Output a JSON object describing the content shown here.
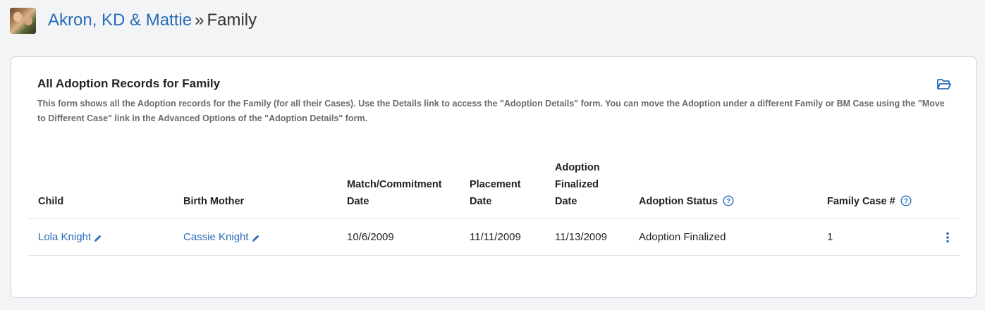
{
  "header": {
    "family_name": "Akron, KD & Mattie",
    "separator": "»",
    "current": "Family"
  },
  "card": {
    "title": "All Adoption Records for Family",
    "description": "This form shows all the Adoption records for the Family (for all their Cases). Use the Details link to access the \"Adoption Details\" form. You can move the Adoption under a different Family or BM Case using the \"Move to Different Case\" link in the Advanced Options of the \"Adoption Details\" form."
  },
  "table": {
    "columns": {
      "child": "Child",
      "birth_mother": "Birth Mother",
      "match_line1": "Match/Commitment",
      "match_line2": "Date",
      "placement_line1": "Placement",
      "placement_line2": "Date",
      "finalized_line1": "Adoption",
      "finalized_line2": "Finalized",
      "finalized_line3": "Date",
      "status": "Adoption Status",
      "family_case": "Family Case #"
    },
    "rows": [
      {
        "child": "Lola Knight",
        "birth_mother": "Cassie Knight",
        "match_date": "10/6/2009",
        "placement_date": "11/11/2009",
        "finalized_date": "11/13/2009",
        "status": "Adoption Finalized",
        "family_case": "1"
      }
    ]
  },
  "colors": {
    "link": "#2a6cb8",
    "background": "#f3f4f6"
  }
}
